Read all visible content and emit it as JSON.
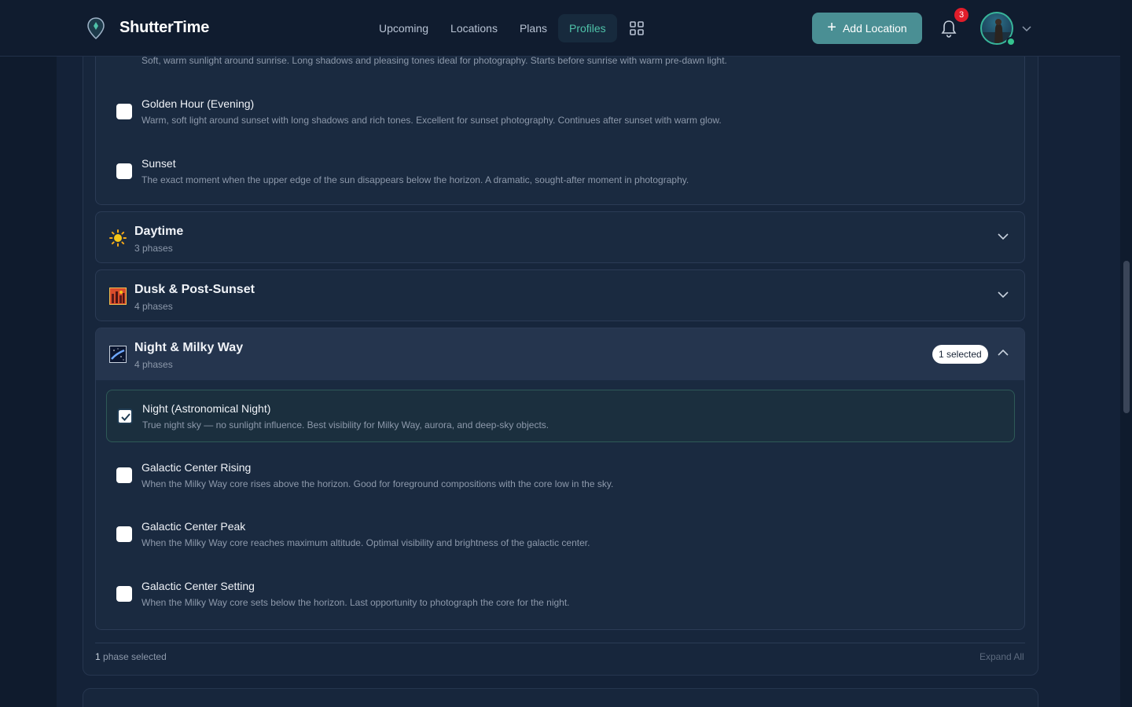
{
  "header": {
    "brand": "ShutterTime",
    "nav": [
      "Upcoming",
      "Locations",
      "Plans",
      "Profiles"
    ],
    "active_nav": "Profiles",
    "add_button": "Add Location",
    "notification_count": "3"
  },
  "top_partial": {
    "desc": "Soft, warm sunlight around sunrise. Long shadows and pleasing tones ideal for photography. Starts before sunrise with warm pre-dawn light."
  },
  "golden_group_phases": [
    {
      "title": "Golden Hour (Evening)",
      "desc": "Warm, soft light around sunset with long shadows and rich tones. Excellent for sunset photography. Continues after sunset with warm glow.",
      "checked": false
    },
    {
      "title": "Sunset",
      "desc": "The exact moment when the upper edge of the sun disappears below the horizon. A dramatic, sought-after moment in photography.",
      "checked": false
    }
  ],
  "groups": [
    {
      "title": "Daytime",
      "sub": "3 phases",
      "icon": "sun-icon",
      "expanded": false
    },
    {
      "title": "Dusk & Post-Sunset",
      "sub": "4 phases",
      "icon": "dusk-icon",
      "expanded": false
    },
    {
      "title": "Night & Milky Way",
      "sub": "4 phases",
      "icon": "milky-way-icon",
      "expanded": true,
      "badge": "1 selected"
    }
  ],
  "night_phases": [
    {
      "title": "Night (Astronomical Night)",
      "desc": "True night sky — no sunlight influence. Best visibility for Milky Way, aurora, and deep-sky objects.",
      "checked": true
    },
    {
      "title": "Galactic Center Rising",
      "desc": "When the Milky Way core rises above the horizon. Good for foreground compositions with the core low in the sky.",
      "checked": false
    },
    {
      "title": "Galactic Center Peak",
      "desc": "When the Milky Way core reaches maximum altitude. Optimal visibility and brightness of the galactic center.",
      "checked": false
    },
    {
      "title": "Galactic Center Setting",
      "desc": "When the Milky Way core sets below the horizon. Last opportunity to photograph the core for the night.",
      "checked": false
    }
  ],
  "footer": {
    "count": "1",
    "count_label": " phase selected",
    "expand_all": "Expand All"
  },
  "colors": {
    "accent": "#4fc2a9",
    "button": "#4a8f94",
    "badge": "#e11d2a",
    "background": "#0f1b2d"
  }
}
